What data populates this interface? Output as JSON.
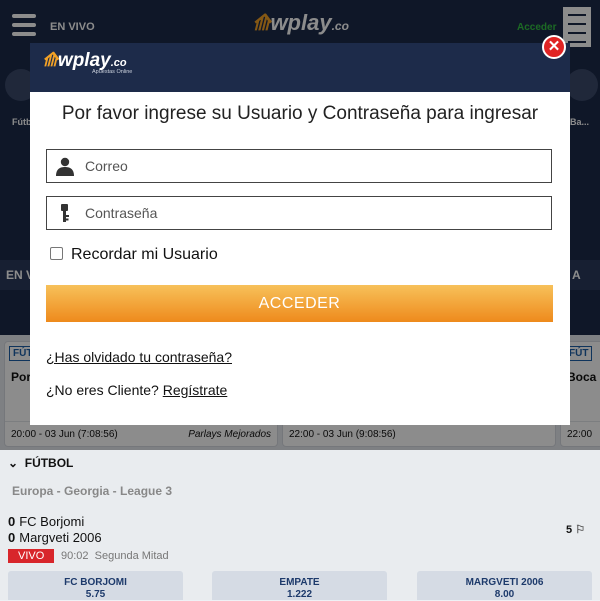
{
  "header": {
    "nav_label": "EN VIVO",
    "brand": "wplay",
    "brand_suffix": ".co",
    "login_link": "Acceder"
  },
  "background": {
    "tabs_visible": [
      "EN V",
      "A"
    ],
    "sport_labels": [
      "Fútb",
      "Ba..."
    ],
    "cards": [
      {
        "tag": "FÚT",
        "title": "Por",
        "time": "20:00 - 03 Jun (7:08:56)",
        "extra": "Parlays Mejorados"
      },
      {
        "tag": "",
        "title": "",
        "time": "22:00 - 03 Jun (9:08:56)",
        "extra": ""
      },
      {
        "tag": "FÚT",
        "title": "Boca",
        "time": "22:00",
        "extra": ""
      }
    ],
    "section_title": "FÚTBOL",
    "league": "Europa - Georgia - League 3",
    "match": {
      "home_score": "0",
      "home_team": "FC Borjomi",
      "away_score": "0",
      "away_team": "Margveti 2006",
      "status_badge": "VIVO",
      "time": "90:02",
      "period": "Segunda Mitad",
      "stats_count": "5"
    },
    "odds": [
      {
        "label": "FC BORJOMI",
        "value": "5.75"
      },
      {
        "label": "EMPATE",
        "value": "1.222"
      },
      {
        "label": "MARGVETI 2006",
        "value": "8.00"
      }
    ]
  },
  "modal": {
    "brand": "wplay",
    "brand_suffix": ".co",
    "tagline": "Apuestas Online",
    "title": "Por favor ingrese su Usuario y Contraseña para ingresar",
    "email_placeholder": "Correo",
    "password_placeholder": "Contraseña",
    "remember_label": "Recordar mi Usuario",
    "remember_checked": false,
    "submit_label": "ACCEDER",
    "forgot_link": "¿Has olvidado tu contraseña?",
    "no_client_text": "¿No eres Cliente?",
    "register_link": "Regístrate"
  },
  "colors": {
    "navy": "#1d2b4a",
    "accent_orange": "#ee8a1c",
    "close_red": "#e02424",
    "live_red": "#d8262b",
    "login_green": "#34c142"
  }
}
